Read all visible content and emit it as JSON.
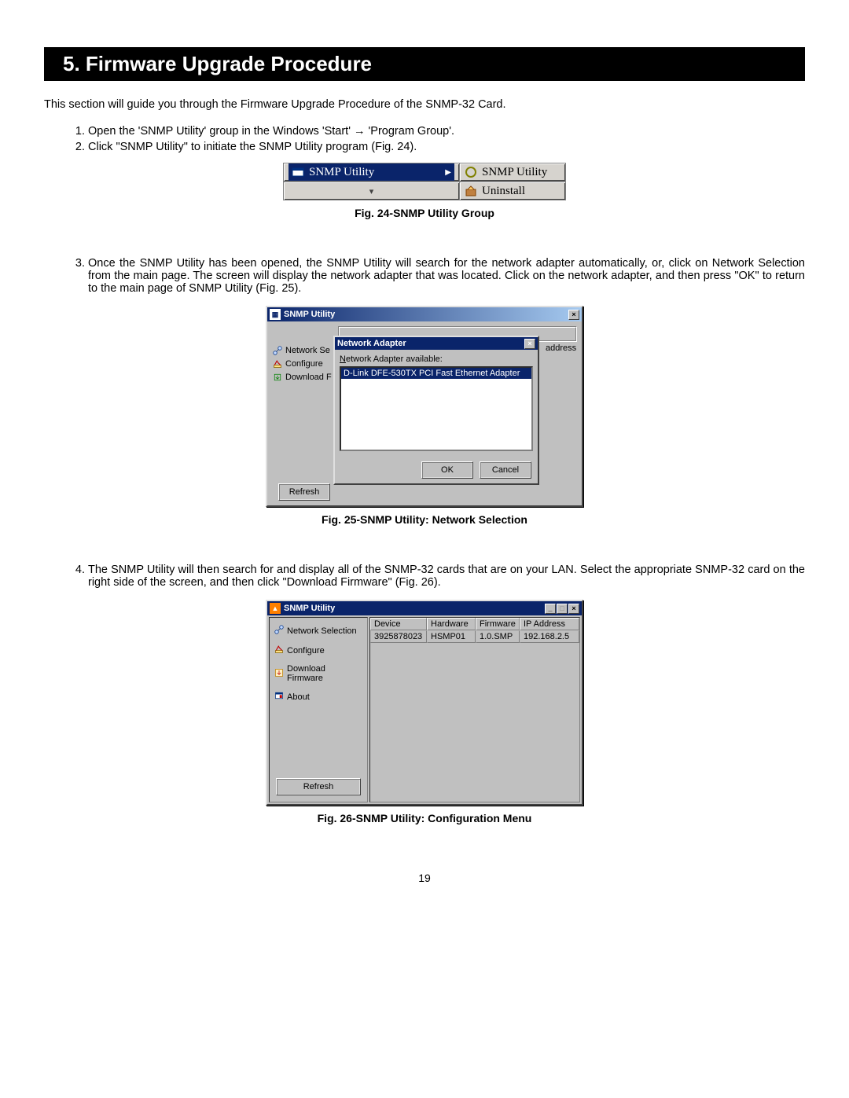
{
  "heading": "5.   Firmware Upgrade Procedure",
  "intro": "This section will guide you through the Firmware Upgrade Procedure of the SNMP-32 Card.",
  "steps": {
    "s1": "Open the 'SNMP Utility' group in the Windows 'Start' → 'Program Group'.",
    "s2": "Click \"SNMP Utility\" to initiate the SNMP Utility program (Fig. 24).",
    "s3": "Once the SNMP Utility has been opened, the SNMP Utility will search for the network adapter automatically, or, click on Network Selection from the main page.  The screen will display the network adapter that was located.  Click on the network adapter, and then press \"OK\" to return to the main page of SNMP Utility (Fig. 25).",
    "s4": "The SNMP Utility will then search for and display all of the SNMP-32 cards that are on your LAN.  Select the appropriate SNMP-32 card on the right side of the screen, and then click \"Download Firmware\" (Fig. 26)."
  },
  "fig24": {
    "caption": "Fig. 24-SNMP Utility Group",
    "left_item": "SNMP Utility",
    "right_item1": "SNMP Utility",
    "right_item2": "Uninstall"
  },
  "fig25": {
    "caption": "Fig. 25-SNMP Utility: Network Selection",
    "title": "SNMP Utility",
    "side_network": "Network Se",
    "side_configure": "Configure",
    "side_download": "Download F",
    "refresh": "Refresh",
    "addr_col": "address",
    "dlg_title": "Network Adapter",
    "dlg_label_html": "Network Adapter available:",
    "adapter": "D-Link DFE-530TX PCI Fast Ethernet Adapter",
    "ok": "OK",
    "cancel": "Cancel"
  },
  "fig26": {
    "caption": "Fig. 26-SNMP Utility: Configuration Menu",
    "title": "SNMP Utility",
    "nav_network": "Network Selection",
    "nav_configure": "Configure",
    "nav_download": "Download Firmware",
    "nav_about": "About",
    "refresh": "Refresh",
    "hdr_device": "Device",
    "hdr_hardware": "Hardware",
    "hdr_firmware": "Firmware",
    "hdr_ip": "IP Address",
    "row_device": "3925878023",
    "row_hardware": "HSMP01",
    "row_firmware": "1.0.SMP",
    "row_ip": "192.168.2.5"
  },
  "page_number": "19"
}
